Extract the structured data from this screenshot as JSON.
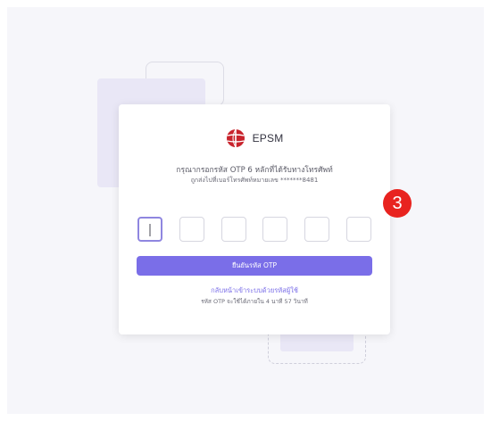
{
  "brand": {
    "name": "EPSM",
    "logo_icon": "epsm-globe-logo-icon",
    "logo_color": "#c8232c"
  },
  "instructions": {
    "main": "กรุณากรอกรหัส OTP 6 หลักที่ได้รับทางโทรศัพท์",
    "sub": "ถูกส่งไปที่เบอร์โทรศัพท์หมายเลข *******8481"
  },
  "otp": {
    "length": 6,
    "values": [
      "",
      "",
      "",
      "",
      "",
      ""
    ],
    "active_index": 0
  },
  "actions": {
    "verify_label": "ยืนยันรหัส OTP",
    "back_link": "กลับหน้าเข้าระบบด้วยรหัสผู้ใช้"
  },
  "expiry": {
    "text": "รหัส OTP จะใช้ได้ภายใน 4 นาที 57 วินาที"
  },
  "annotation": {
    "step_number": "3",
    "color": "#e8231f"
  },
  "colors": {
    "primary": "#7a6ee8",
    "background": "#f6f6fa"
  }
}
